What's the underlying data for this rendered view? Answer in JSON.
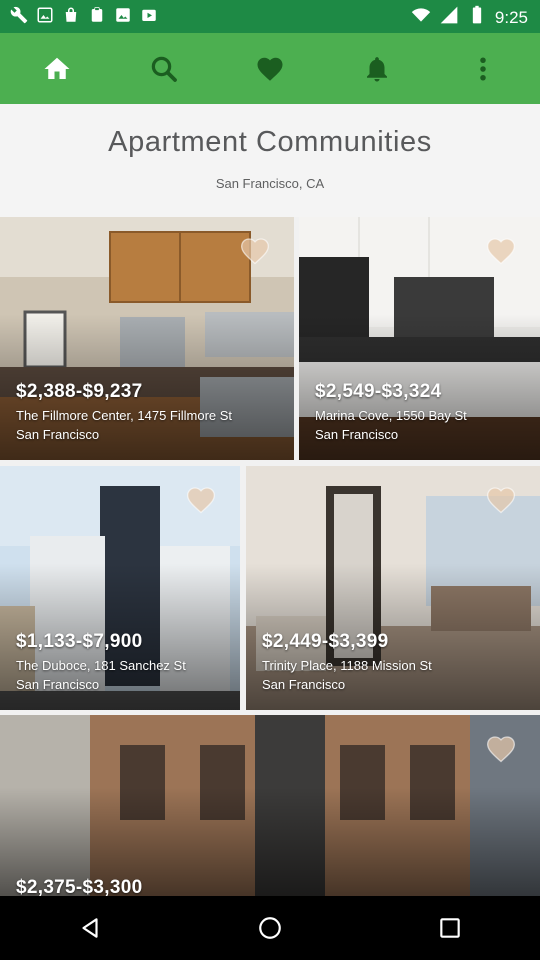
{
  "status_bar": {
    "time": "9:25",
    "icons": [
      "wrench-icon",
      "gallery-icon",
      "bag-icon",
      "clipboard-icon",
      "image-icon",
      "play-store-icon",
      "wifi-icon",
      "signal-icon",
      "battery-icon"
    ]
  },
  "app_bar": {
    "tabs": [
      "home-icon",
      "search-icon",
      "heart-icon",
      "bell-icon",
      "more-vert-icon"
    ],
    "active_tab": "home-icon",
    "colors": {
      "bar": "#4caf50",
      "active_tab": "#ffffff",
      "inactive_icon": "#1b5e20"
    }
  },
  "header": {
    "title": "Apartment Communities",
    "subtitle": "San Francisco, CA"
  },
  "listings": [
    {
      "price": "$2,388-$9,237",
      "name": "The Fillmore Center, 1475 Fillmore St",
      "city": "San Francisco"
    },
    {
      "price": "$2,549-$3,324",
      "name": "Marina Cove, 1550 Bay St",
      "city": "San Francisco"
    },
    {
      "price": "$1,133-$7,900",
      "name": "The Duboce, 181 Sanchez St",
      "city": "San Francisco"
    },
    {
      "price": "$2,449-$3,399",
      "name": "Trinity Place, 1188 Mission St",
      "city": "San Francisco"
    },
    {
      "price": "$2,375-$3,300",
      "name": "",
      "city": ""
    }
  ],
  "nav_bar": {
    "buttons": [
      "back-icon",
      "home-circle-icon",
      "recents-icon"
    ]
  }
}
